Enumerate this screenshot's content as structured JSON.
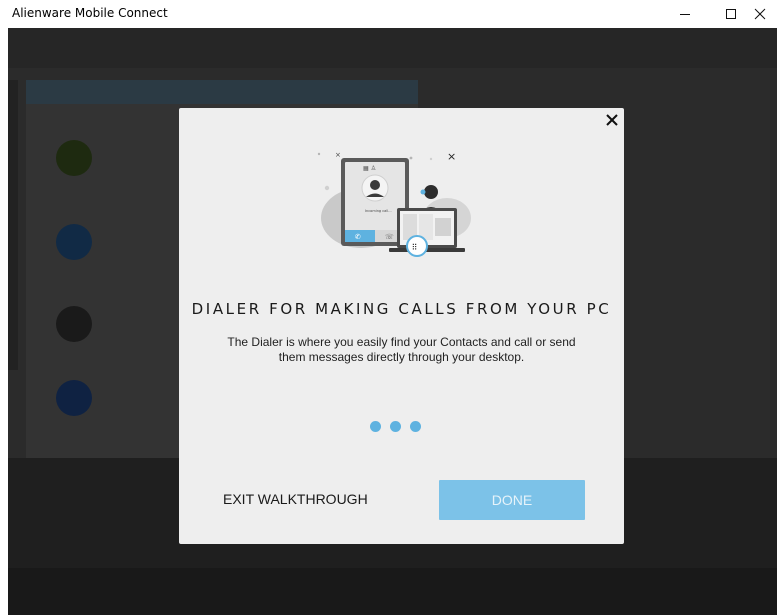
{
  "window": {
    "title": "Alienware Mobile Connect",
    "controls": [
      "minimize-icon",
      "maximize-icon",
      "close-icon"
    ]
  },
  "modal": {
    "close_icon": "close-icon",
    "illustration": "dialer-illustration",
    "heading": "DIALER FOR MAKING CALLS FROM YOUR PC",
    "description": "The Dialer is where you easily find your Contacts and call or send them messages directly through your desktop.",
    "phone_caption": "Incoming call...",
    "pagination": {
      "total": 3
    },
    "exit_label": "EXIT WALKTHROUGH",
    "done_label": "DONE"
  },
  "colors": {
    "accent": "#5eb2e0",
    "done_button": "#7cc2e8",
    "modal_bg": "#eeeeee",
    "overlay_bg": "#2b2b2b"
  }
}
